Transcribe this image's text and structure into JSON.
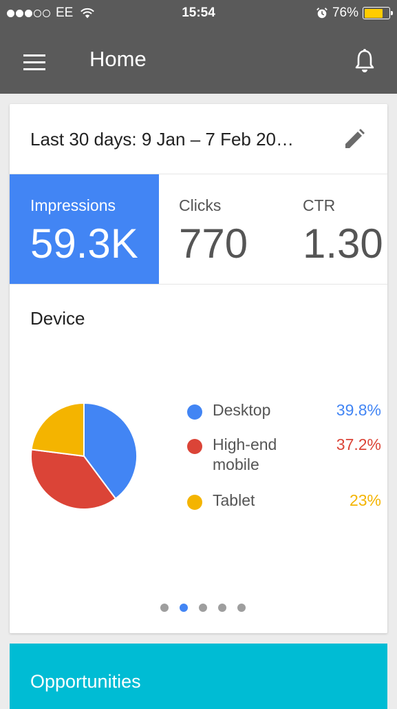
{
  "status_bar": {
    "carrier": "EE",
    "signal_bars_filled": 3,
    "signal_bars_total": 5,
    "time": "15:54",
    "battery_percent": "76%",
    "battery_level": 0.76,
    "battery_color": "#ffcc00",
    "icons": [
      "wifi-icon",
      "alarm-icon",
      "battery-icon"
    ]
  },
  "app_bar": {
    "title": "Home",
    "background": "#5a5a5a",
    "menu_icon": "hamburger-menu-icon",
    "bell_icon": "bell-icon"
  },
  "summary_card": {
    "date_range": "Last 30 days: 9 Jan – 7 Feb 20…",
    "edit_icon": "pencil-icon",
    "metrics": [
      {
        "label": "Impressions",
        "value": "59.3K",
        "active": true,
        "color": "#4285f4"
      },
      {
        "label": "Clicks",
        "value": "770",
        "active": false
      },
      {
        "label": "CTR",
        "value": "1.30",
        "active": false
      }
    ],
    "device": {
      "title": "Device",
      "legend": [
        {
          "label": "Desktop",
          "value": "39.8%",
          "color": "#4285f4"
        },
        {
          "label": "High-end mobile",
          "value": "37.2%",
          "color": "#db4437"
        },
        {
          "label": "Tablet",
          "value": "23%",
          "color": "#f4b400"
        }
      ]
    },
    "pager": {
      "count": 5,
      "active_index": 1,
      "active_color": "#4285f4"
    }
  },
  "chart_data": {
    "type": "pie",
    "categories": [
      "Desktop",
      "High-end mobile",
      "Tablet"
    ],
    "values": [
      39.8,
      37.2,
      23
    ],
    "colors": [
      "#4285f4",
      "#db4437",
      "#f4b400"
    ],
    "title": "Device"
  },
  "opportunities_card": {
    "title": "Opportunities",
    "background": "#00bcd4"
  }
}
